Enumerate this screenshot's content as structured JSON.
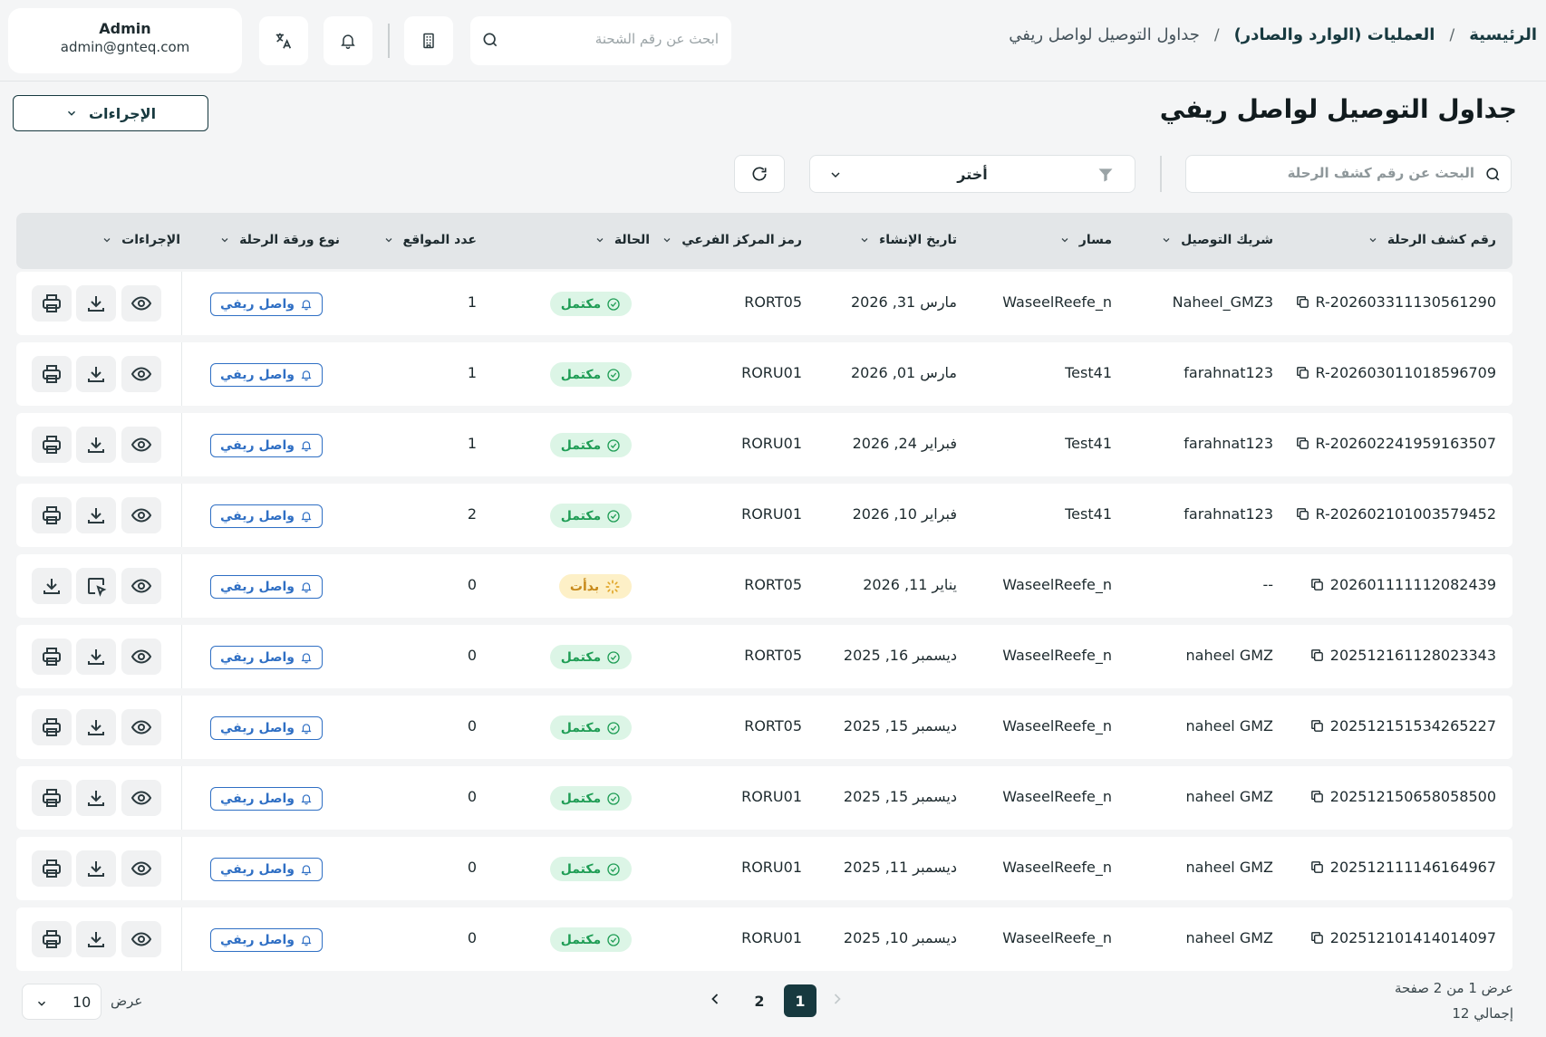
{
  "breadcrumb": {
    "home": "الرئيسية",
    "section": "العمليات (الوارد والصادر)",
    "current": "جداول التوصيل لواصل ريفي",
    "separator": "/"
  },
  "top_search": {
    "placeholder": "ابحث عن رقم الشحنة"
  },
  "user": {
    "name": "Admin",
    "email": "admin@gnteq.com"
  },
  "page": {
    "title": "جداول التوصيل لواصل ريفي",
    "actions_label": "الإجراءات"
  },
  "filters": {
    "trip_search_placeholder": "البحث عن رقم كشف الرحلة",
    "select_label": "أختر"
  },
  "table": {
    "headers": {
      "trip": "رقم كشف الرحلة",
      "partner": "شريك التوصيل",
      "route": "مسار",
      "created": "تاريخ الإنشاء",
      "hub": "رمز المركز الفرعي",
      "status": "الحالة",
      "sites": "عدد المواقع",
      "type": "نوع ورقة الرحلة",
      "actions": "الإجراءات"
    },
    "rows": [
      {
        "trip": "R-202603311130561290",
        "partner": "Naheel_GMZ3",
        "route": "WaseelReefe_n",
        "date": "مارس 31, 2026",
        "hub": "RORT05",
        "status": "مكتمل",
        "status_kind": "done",
        "sites": "1",
        "type": "واصل ريفي"
      },
      {
        "trip": "R-202603011018596709",
        "partner": "farahnat123",
        "route": "Test41",
        "date": "مارس 01, 2026",
        "hub": "RORU01",
        "status": "مكتمل",
        "status_kind": "done",
        "sites": "1",
        "type": "واصل ريفي"
      },
      {
        "trip": "R-202602241959163507",
        "partner": "farahnat123",
        "route": "Test41",
        "date": "فبراير 24, 2026",
        "hub": "RORU01",
        "status": "مكتمل",
        "status_kind": "done",
        "sites": "1",
        "type": "واصل ريفي"
      },
      {
        "trip": "R-202602101003579452",
        "partner": "farahnat123",
        "route": "Test41",
        "date": "فبراير 10, 2026",
        "hub": "RORU01",
        "status": "مكتمل",
        "status_kind": "done",
        "sites": "2",
        "type": "واصل ريفي"
      },
      {
        "trip": "202601111112082439",
        "partner": "--",
        "route": "WaseelReefe_n",
        "date": "يناير 11, 2026",
        "hub": "RORT05",
        "status": "بدأت",
        "status_kind": "started",
        "sites": "0",
        "type": "واصل ريفي"
      },
      {
        "trip": "202512161128023343",
        "partner": "naheel GMZ",
        "route": "WaseelReefe_n",
        "date": "ديسمبر 16, 2025",
        "hub": "RORT05",
        "status": "مكتمل",
        "status_kind": "done",
        "sites": "0",
        "type": "واصل ريفي"
      },
      {
        "trip": "202512151534265227",
        "partner": "naheel GMZ",
        "route": "WaseelReefe_n",
        "date": "ديسمبر 15, 2025",
        "hub": "RORT05",
        "status": "مكتمل",
        "status_kind": "done",
        "sites": "0",
        "type": "واصل ريفي"
      },
      {
        "trip": "202512150658058500",
        "partner": "naheel GMZ",
        "route": "WaseelReefe_n",
        "date": "ديسمبر 15, 2025",
        "hub": "RORU01",
        "status": "مكتمل",
        "status_kind": "done",
        "sites": "0",
        "type": "واصل ريفي"
      },
      {
        "trip": "202512111146164967",
        "partner": "naheel GMZ",
        "route": "WaseelReefe_n",
        "date": "ديسمبر 11, 2025",
        "hub": "RORU01",
        "status": "مكتمل",
        "status_kind": "done",
        "sites": "0",
        "type": "واصل ريفي"
      },
      {
        "trip": "202512101414014097",
        "partner": "naheel GMZ",
        "route": "WaseelReefe_n",
        "date": "ديسمبر 10, 2025",
        "hub": "RORU01",
        "status": "مكتمل",
        "status_kind": "done",
        "sites": "0",
        "type": "واصل ريفي"
      }
    ]
  },
  "pagination": {
    "range_text": "عرض 1 من 2 صفحة",
    "total_text": "إجمالي 12",
    "pages": [
      "1",
      "2"
    ],
    "current_page": "1",
    "show_label": "عرض",
    "page_size": "10"
  },
  "colors": {
    "primary": "#17393f",
    "success_bg": "#dcf5e6",
    "success_text": "#1f9d55",
    "warning_bg": "#fdf0c7",
    "warning_text": "#c7891a",
    "link_blue": "#2f6fc4"
  }
}
